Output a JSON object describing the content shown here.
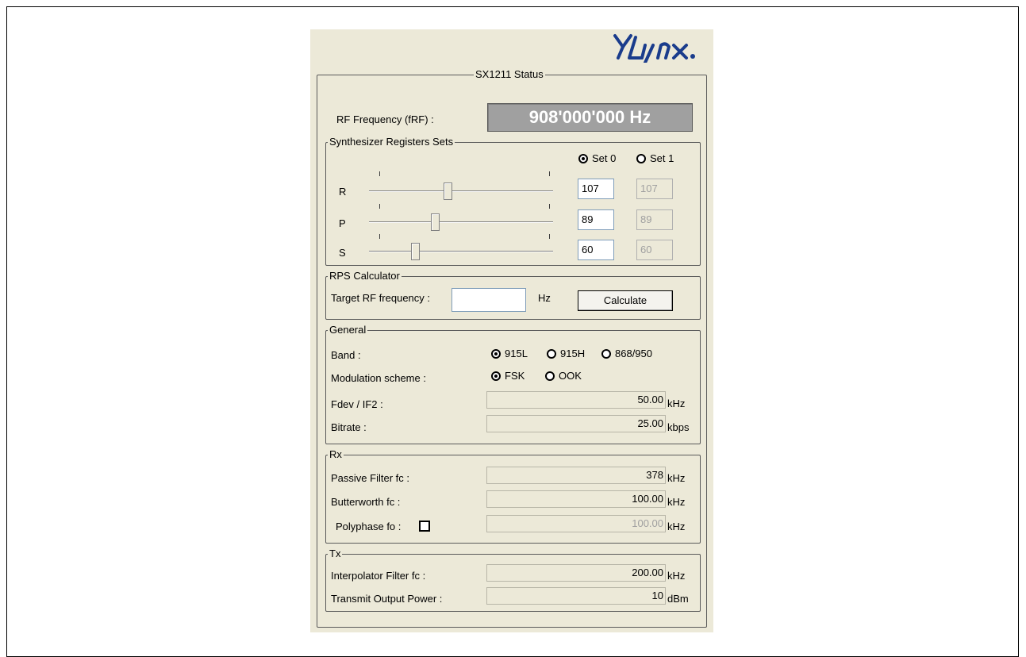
{
  "logo_text": "YLynx",
  "status": {
    "title": "SX1211 Status",
    "rf_label": "RF Frequency (fRF) :",
    "rf_value": "908'000'000 Hz"
  },
  "synth": {
    "title": "Synthesizer Registers Sets",
    "set0_label": "Set 0",
    "set1_label": "Set 1",
    "selected_set": "Set 0",
    "rows": [
      {
        "label": "R",
        "set0": "107",
        "set1": "107",
        "slider_fraction": 0.43
      },
      {
        "label": "P",
        "set0": "89",
        "set1": "89",
        "slider_fraction": 0.36
      },
      {
        "label": "S",
        "set0": "60",
        "set1": "60",
        "slider_fraction": 0.25
      }
    ]
  },
  "rps": {
    "title": "RPS Calculator",
    "target_label": "Target RF frequency :",
    "target_value": "",
    "unit": "Hz",
    "calc_button": "Calculate"
  },
  "general": {
    "title": "General",
    "band_label": "Band :",
    "band_options": [
      "915L",
      "915H",
      "868/950"
    ],
    "band_selected": "915L",
    "mod_label": "Modulation scheme :",
    "mod_options": [
      "FSK",
      "OOK"
    ],
    "mod_selected": "FSK",
    "fdev_label": "Fdev / IF2 :",
    "fdev_value": "50.00",
    "fdev_unit": "kHz",
    "bitrate_label": "Bitrate :",
    "bitrate_value": "25.00",
    "bitrate_unit": "kbps"
  },
  "rx": {
    "title": "Rx",
    "passive_label": "Passive Filter fc :",
    "passive_value": "378",
    "passive_unit": "kHz",
    "butter_label": "Butterworth fc :",
    "butter_value": "100.00",
    "butter_unit": "kHz",
    "poly_label": "Polyphase fo :",
    "poly_checked": false,
    "poly_value": "100.00",
    "poly_unit": "kHz"
  },
  "tx": {
    "title": "Tx",
    "interp_label": "Interpolator Filter fc :",
    "interp_value": "200.00",
    "interp_unit": "kHz",
    "power_label": "Transmit Output Power :",
    "power_value": "10",
    "power_unit": "dBm"
  },
  "colors": {
    "panel_bg": "#ece9d8",
    "display_bg": "#a0a0a0",
    "logo": "#1a3c8c"
  }
}
